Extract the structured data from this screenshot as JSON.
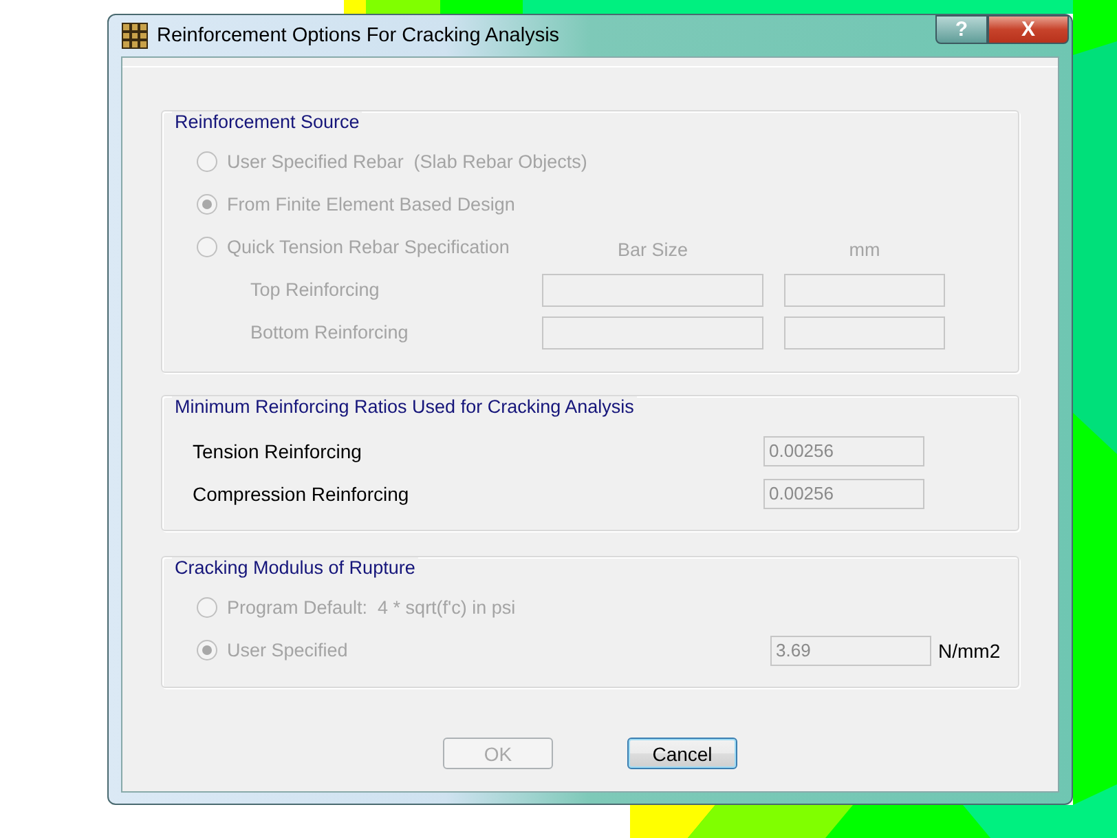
{
  "window": {
    "title": "Reinforcement Options For Cracking Analysis",
    "help_button": "?",
    "close_button": "X"
  },
  "reinforcement_source": {
    "title": "Reinforcement Source",
    "options": [
      {
        "label": "User Specified Rebar  (Slab Rebar Objects)",
        "selected": false,
        "disabled": true
      },
      {
        "label": "From Finite Element Based Design",
        "selected": true,
        "disabled": true
      },
      {
        "label": "Quick Tension Rebar Specification",
        "selected": false,
        "disabled": true
      }
    ],
    "columns": [
      "Bar Size",
      "mm"
    ],
    "rows": [
      {
        "label": "Top Reinforcing",
        "disabled": true
      },
      {
        "label": "Bottom Reinforcing",
        "disabled": true
      }
    ]
  },
  "minimum_ratios": {
    "title": "Minimum Reinforcing Ratios Used for Cracking Analysis",
    "rows": [
      {
        "label": "Tension Reinforcing",
        "value": "0.00256",
        "disabled": true
      },
      {
        "label": "Compression Reinforcing",
        "value": "0.00256",
        "disabled": true
      }
    ]
  },
  "modulus_of_rupture": {
    "title": "Cracking Modulus of Rupture",
    "options": [
      {
        "label": "Program Default:  4 * sqrt(f'c) in psi",
        "selected": false,
        "disabled": true
      },
      {
        "label": "User Specified",
        "selected": true,
        "disabled": true,
        "value": "3.69",
        "unit": "N/mm2"
      }
    ]
  },
  "buttons": [
    {
      "label": "OK",
      "disabled": true,
      "focused": false
    },
    {
      "label": "Cancel",
      "disabled": false,
      "focused": true
    }
  ]
}
